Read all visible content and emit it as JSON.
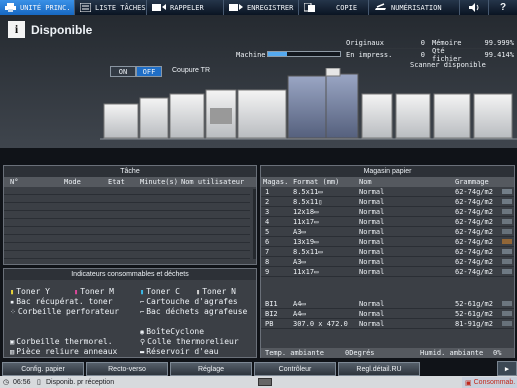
{
  "tabs": [
    {
      "label": "UNITÉ PRINC.",
      "icon": "printer-icon"
    },
    {
      "label": "LISTE TÂCHES",
      "icon": "list-icon"
    },
    {
      "label": "RAPPELER",
      "icon": "recall-icon"
    },
    {
      "label": "ENREGISTRER",
      "icon": "save-icon"
    },
    {
      "label": "COPIE",
      "icon": "copy-icon"
    },
    {
      "label": "NUMÉRISATION",
      "icon": "scan-icon"
    }
  ],
  "header": {
    "status": "Disponible",
    "status_icon": "info-icon",
    "machine_label": "Machine",
    "machine_progress": 0.26,
    "toggle_on": "ON",
    "toggle_off": "OFF",
    "coupure": "Coupure TR",
    "scanner": "Scanner disponible"
  },
  "counters": [
    {
      "label": "Originaux",
      "value": "0",
      "label2": "Mémoire",
      "value2": "99.999%"
    },
    {
      "label": "En impress.",
      "value": "0",
      "label2": "Qté fichier",
      "value2": "99.414%"
    }
  ],
  "tache": {
    "title": "Tâche",
    "columns": {
      "n": "N°",
      "mode": "Mode",
      "etat": "Etat",
      "minutes": "Minute(s)",
      "user": "Nom utilisateur"
    }
  },
  "conso": {
    "title": "Indicateurs consommables et déchets",
    "items": [
      {
        "label": "Toner Y",
        "icon": "toner-y-icon"
      },
      {
        "label": "Toner M",
        "icon": "toner-m-icon"
      },
      {
        "label": "Toner C",
        "icon": "toner-c-icon"
      },
      {
        "label": "Toner N",
        "icon": "toner-n-icon"
      },
      {
        "label": "Bac récupérat. toner",
        "icon": "waste-toner-icon"
      },
      {
        "label": "Cartouche d'agrafes",
        "icon": "staple-cartridge-icon"
      },
      {
        "label": "Corbeille perforateur",
        "icon": "punch-waste-icon"
      },
      {
        "label": "Bac déchets agrafeuse",
        "icon": "staple-waste-icon"
      },
      {
        "label": "BoîteCyclone",
        "icon": "cyclone-box-icon"
      },
      {
        "label": "Corbeille thermorel.",
        "icon": "thermal-waste-icon"
      },
      {
        "label": "Colle thermorelieur",
        "icon": "glue-icon"
      },
      {
        "label": "Pièce reliure anneaux",
        "icon": "ring-binding-icon"
      },
      {
        "label": "Réservoir d'eau",
        "icon": "water-tank-icon"
      }
    ]
  },
  "magasin": {
    "title": "Magasin papier",
    "columns": {
      "mag": "Magas.",
      "format": "Format (mm)",
      "nom": "Nom",
      "grammage": "Grammage"
    },
    "rows": [
      {
        "mag": "1",
        "format": "8.5x11▭",
        "nom": "Normal",
        "grammage": "62-74g/m2",
        "level": 0.8
      },
      {
        "mag": "2",
        "format": "8.5x11▯",
        "nom": "Normal",
        "grammage": "62-74g/m2",
        "level": 0.7
      },
      {
        "mag": "3",
        "format": "12x18▭",
        "nom": "Normal",
        "grammage": "62-74g/m2",
        "level": 0.6
      },
      {
        "mag": "4",
        "format": "11x17▭",
        "nom": "Normal",
        "grammage": "62-74g/m2",
        "level": 0.6
      },
      {
        "mag": "5",
        "format": "A3▭",
        "nom": "Normal",
        "grammage": "62-74g/m2",
        "level": 0.5
      },
      {
        "mag": "6",
        "format": "13x19▭",
        "nom": "Normal",
        "grammage": "62-74g/m2",
        "level": 0.2
      },
      {
        "mag": "7",
        "format": "8.5x11▭",
        "nom": "Normal",
        "grammage": "62-74g/m2",
        "level": 0.7
      },
      {
        "mag": "8",
        "format": "A3▭",
        "nom": "Normal",
        "grammage": "62-74g/m2",
        "level": 0.6
      },
      {
        "mag": "9",
        "format": "11x17▭",
        "nom": "Normal",
        "grammage": "62-74g/m2",
        "level": 0.7
      },
      {
        "mag": "BI1",
        "format": "A4▭",
        "nom": "Normal",
        "grammage": "52-61g/m2",
        "level": 0.6
      },
      {
        "mag": "BI2",
        "format": "A4▭",
        "nom": "Normal",
        "grammage": "52-61g/m2",
        "level": 0.6
      },
      {
        "mag": "PB",
        "format": "307.0 x 472.0",
        "nom": "Normal",
        "grammage": "81-91g/m2",
        "level": 0.5
      }
    ],
    "temp_label": "Temp. ambiante",
    "temp_value": "0Degrés",
    "humid_label": "Humid. ambiante",
    "humid_value": "0%"
  },
  "buttons": [
    "Config. papier",
    "Recto-verso",
    "Réglage",
    "Contrôleur",
    "Regl.détail.RU"
  ],
  "statusbar": {
    "time": "06:56",
    "message": "Disponib. pr réception",
    "consom": "Consommab."
  },
  "colors": {
    "accent": "#1f6ec6",
    "tab_active": "#2a80d8",
    "panel": "#3b3f45",
    "bg": "#101318"
  }
}
